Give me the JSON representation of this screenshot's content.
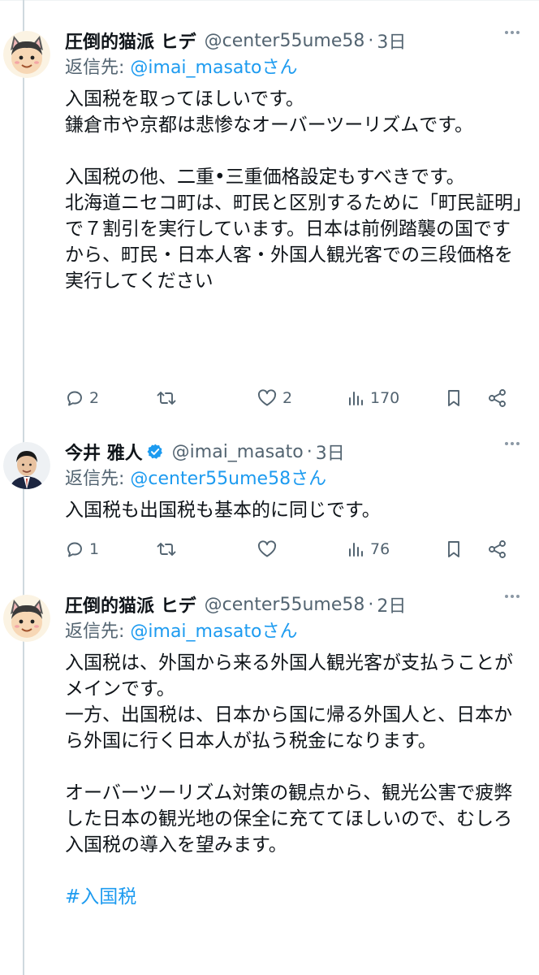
{
  "tweets": [
    {
      "name": "圧倒的猫派 ヒデ",
      "handle": "@center55ume58",
      "time": "3日",
      "replying_prefix": "返信先: ",
      "replying_to": "@imai_masatoさん",
      "body": "入国税を取ってほしいです。\n鎌倉市や京都は悲惨なオーバーツーリズムです。\n\n入国税の他、二重•三重価格設定もすべきです。\n北海道ニセコ町は、町民と区別するために「町民証明」で７割引を実行しています。日本は前例踏襲の国ですから、町民・日本人客・外国人観光客での三段価格を実行してください",
      "replies": "2",
      "retweets": "",
      "likes": "2",
      "views": "170"
    },
    {
      "name": "今井 雅人",
      "handle": "@imai_masato",
      "time": "3日",
      "replying_prefix": "返信先: ",
      "replying_to": "@center55ume58さん",
      "body": "入国税も出国税も基本的に同じです。",
      "replies": "1",
      "retweets": "",
      "likes": "",
      "views": "76"
    },
    {
      "name": "圧倒的猫派 ヒデ",
      "handle": "@center55ume58",
      "time": "2日",
      "replying_prefix": "返信先: ",
      "replying_to": "@imai_masatoさん",
      "body": "入国税は、外国から来る外国人観光客が支払うことがメインです。\n一方、出国税は、日本から国に帰る外国人と、日本から外国に行く日本人が払う税金になります。\n\nオーバーツーリズム対策の観点から、観光公害で疲弊した日本の観光地の保全に充ててほしいので、むしろ入国税の導入を望みます。",
      "hashtag": "#入国税"
    }
  ],
  "colors": {
    "text": "#0f1419",
    "secondary": "#536471",
    "link": "#1d9bf0",
    "thread_line": "#cfd9de"
  },
  "icons": [
    "reply-icon",
    "retweet-icon",
    "like-icon",
    "views-icon",
    "bookmark-icon",
    "share-icon",
    "more-icon",
    "verified-badge-icon"
  ]
}
